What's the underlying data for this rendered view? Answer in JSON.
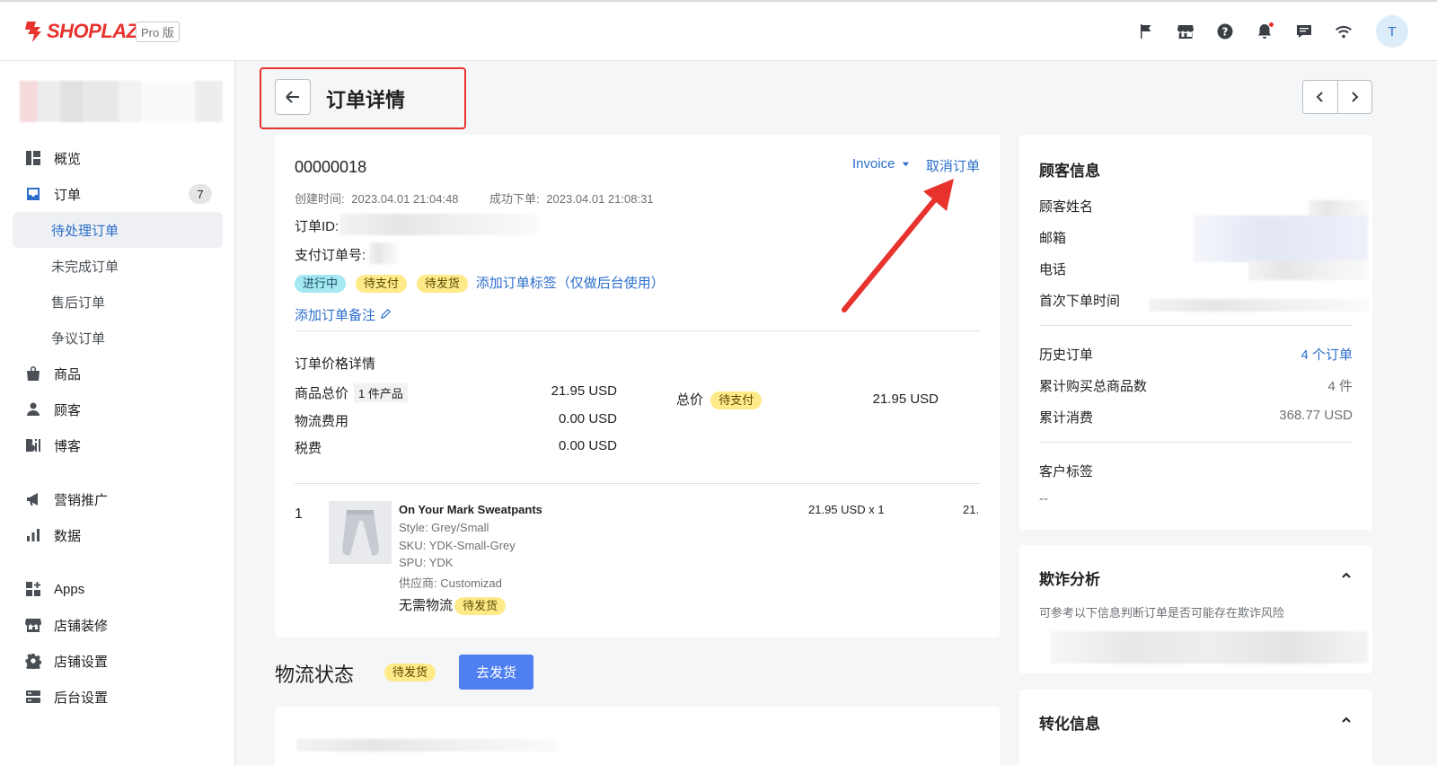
{
  "header": {
    "brand": "SHOPLAZZA",
    "plan_badge": "Pro 版",
    "avatar_letter": "T",
    "icons": [
      "flag-icon",
      "store-icon",
      "help-icon",
      "bell-icon",
      "chat-icon",
      "wifi-icon"
    ]
  },
  "sidebar": {
    "items": [
      {
        "label": "概览",
        "icon": "dashboard-icon"
      },
      {
        "label": "订单",
        "icon": "orders-icon",
        "count": "7"
      },
      {
        "label": "待处理订单",
        "sub": true,
        "active": true
      },
      {
        "label": "未完成订单",
        "sub": true
      },
      {
        "label": "售后订单",
        "sub": true
      },
      {
        "label": "争议订单",
        "sub": true
      },
      {
        "label": "商品",
        "icon": "bag-icon"
      },
      {
        "label": "顾客",
        "icon": "person-icon"
      },
      {
        "label": "博客",
        "icon": "blog-icon"
      },
      {
        "label": "营销推广",
        "icon": "megaphone-icon"
      },
      {
        "label": "数据",
        "icon": "chart-icon"
      },
      {
        "label": "Apps",
        "icon": "apps-icon"
      },
      {
        "label": "店铺装修",
        "icon": "storefront-icon"
      },
      {
        "label": "店铺设置",
        "icon": "gear-icon"
      },
      {
        "label": "后台设置",
        "icon": "server-icon"
      }
    ]
  },
  "page": {
    "title": "订单详情"
  },
  "order": {
    "number": "00000018",
    "invoice_label": "Invoice",
    "cancel_label": "取消订单",
    "created_label": "创建时间:",
    "created_value": "2023.04.01 21:04:48",
    "placed_label": "成功下单:",
    "placed_value": "2023.04.01 21:08:31",
    "order_id_label": "订单ID:",
    "payment_no_label": "支付订单号:",
    "tags": [
      "进行中",
      "待支付",
      "待发货"
    ],
    "add_tag_link": "添加订单标签（仅做后台使用）",
    "add_note_link": "添加订单备注"
  },
  "price": {
    "section_title": "订单价格详情",
    "subtotal_label": "商品总价",
    "subtotal_qty": "1 件产品",
    "subtotal_value": "21.95 USD",
    "shipping_label": "物流费用",
    "shipping_value": "0.00 USD",
    "tax_label": "税费",
    "tax_value": "0.00 USD",
    "total_label": "总价",
    "total_status": "待支付",
    "total_value": "21.95 USD"
  },
  "line_item": {
    "index": "1",
    "name": "On Your Mark Sweatpants",
    "style": "Style: Grey/Small",
    "sku": "SKU: YDK-Small-Grey",
    "spu": "SPU: YDK",
    "vendor": "供应商: Customizad",
    "shipping_note": "无需物流",
    "shipping_status": "待发货",
    "unit_price": "21.95 USD x 1",
    "line_total": "21."
  },
  "logistics": {
    "title": "物流状态",
    "status": "待发货",
    "ship_button": "去发货"
  },
  "customer": {
    "title": "顾客信息",
    "name_label": "顾客姓名",
    "email_label": "邮箱",
    "phone_label": "电话",
    "first_order_label": "首次下单时间",
    "history_label": "历史订单",
    "history_value": "4 个订单",
    "items_label": "累计购买总商品数",
    "items_value": "4 件",
    "spend_label": "累计消费",
    "spend_value": "368.77 USD",
    "tags_label": "客户标签",
    "tags_value": "--"
  },
  "fraud": {
    "title": "欺诈分析",
    "desc": "可参考以下信息判断订单是否可能存在欺诈风险"
  },
  "conversion": {
    "title": "转化信息"
  },
  "colors": {
    "brand_red": "#e8322e",
    "link_blue": "#2c6ecb",
    "button_blue": "#4f7ff0"
  }
}
